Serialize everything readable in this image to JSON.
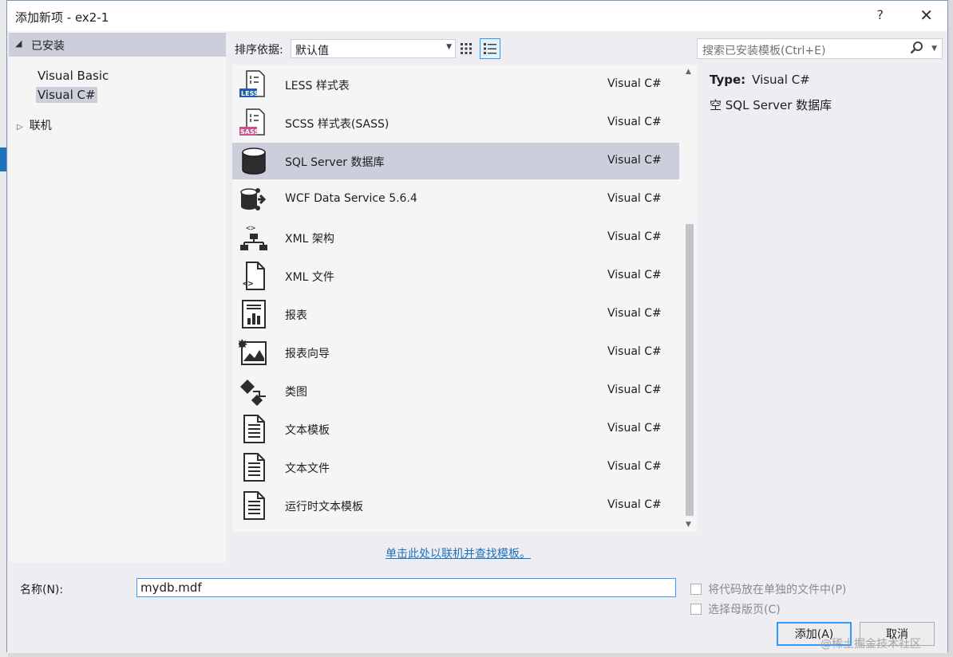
{
  "window": {
    "title": "添加新项 - ex2-1",
    "help": "?",
    "close": "✕"
  },
  "left_pane": {
    "installed_label": "已安装",
    "items": [
      {
        "label": "Visual Basic",
        "selected": false
      },
      {
        "label": "Visual C#",
        "selected": true
      }
    ],
    "online_label": "联机"
  },
  "toolbar": {
    "sort_label": "排序依据:",
    "sort_value": "默认值",
    "view_icons": [
      "grid-view-icon",
      "list-view-icon"
    ],
    "search_placeholder": "搜索已安装模板(Ctrl+E)"
  },
  "templates": [
    {
      "name": "LESS 样式表",
      "lang": "Visual C#",
      "icon": "less-stylesheet-icon",
      "selected": false
    },
    {
      "name": "SCSS 样式表(SASS)",
      "lang": "Visual C#",
      "icon": "scss-stylesheet-icon",
      "selected": false
    },
    {
      "name": "SQL Server 数据库",
      "lang": "Visual C#",
      "icon": "database-icon",
      "selected": true
    },
    {
      "name": "WCF Data Service 5.6.4",
      "lang": "Visual C#",
      "icon": "data-service-icon",
      "selected": false
    },
    {
      "name": "XML 架构",
      "lang": "Visual C#",
      "icon": "xml-schema-icon",
      "selected": false
    },
    {
      "name": "XML 文件",
      "lang": "Visual C#",
      "icon": "xml-file-icon",
      "selected": false
    },
    {
      "name": "报表",
      "lang": "Visual C#",
      "icon": "report-icon",
      "selected": false
    },
    {
      "name": "报表向导",
      "lang": "Visual C#",
      "icon": "report-wizard-icon",
      "selected": false
    },
    {
      "name": "类图",
      "lang": "Visual C#",
      "icon": "class-diagram-icon",
      "selected": false
    },
    {
      "name": "文本模板",
      "lang": "Visual C#",
      "icon": "text-template-icon",
      "selected": false
    },
    {
      "name": "文本文件",
      "lang": "Visual C#",
      "icon": "text-file-icon",
      "selected": false
    },
    {
      "name": "运行时文本模板",
      "lang": "Visual C#",
      "icon": "runtime-text-template-icon",
      "selected": false
    }
  ],
  "details": {
    "type_label": "Type:",
    "type_value": "Visual C#",
    "description": "空 SQL Server 数据库"
  },
  "online_link": "单击此处以联机并查找模板。",
  "footer": {
    "name_label": "名称(N):",
    "name_value": "mydb.mdf",
    "checkbox1": "将代码放在单独的文件中(P)",
    "checkbox2": "选择母版页(C)",
    "add_button": "添加(A)",
    "cancel_button": "取消"
  },
  "watermark": "@稀土掘金技术社区",
  "colors": {
    "selection": "#cccedb",
    "accent": "#3399ff",
    "link": "#1e73be"
  }
}
